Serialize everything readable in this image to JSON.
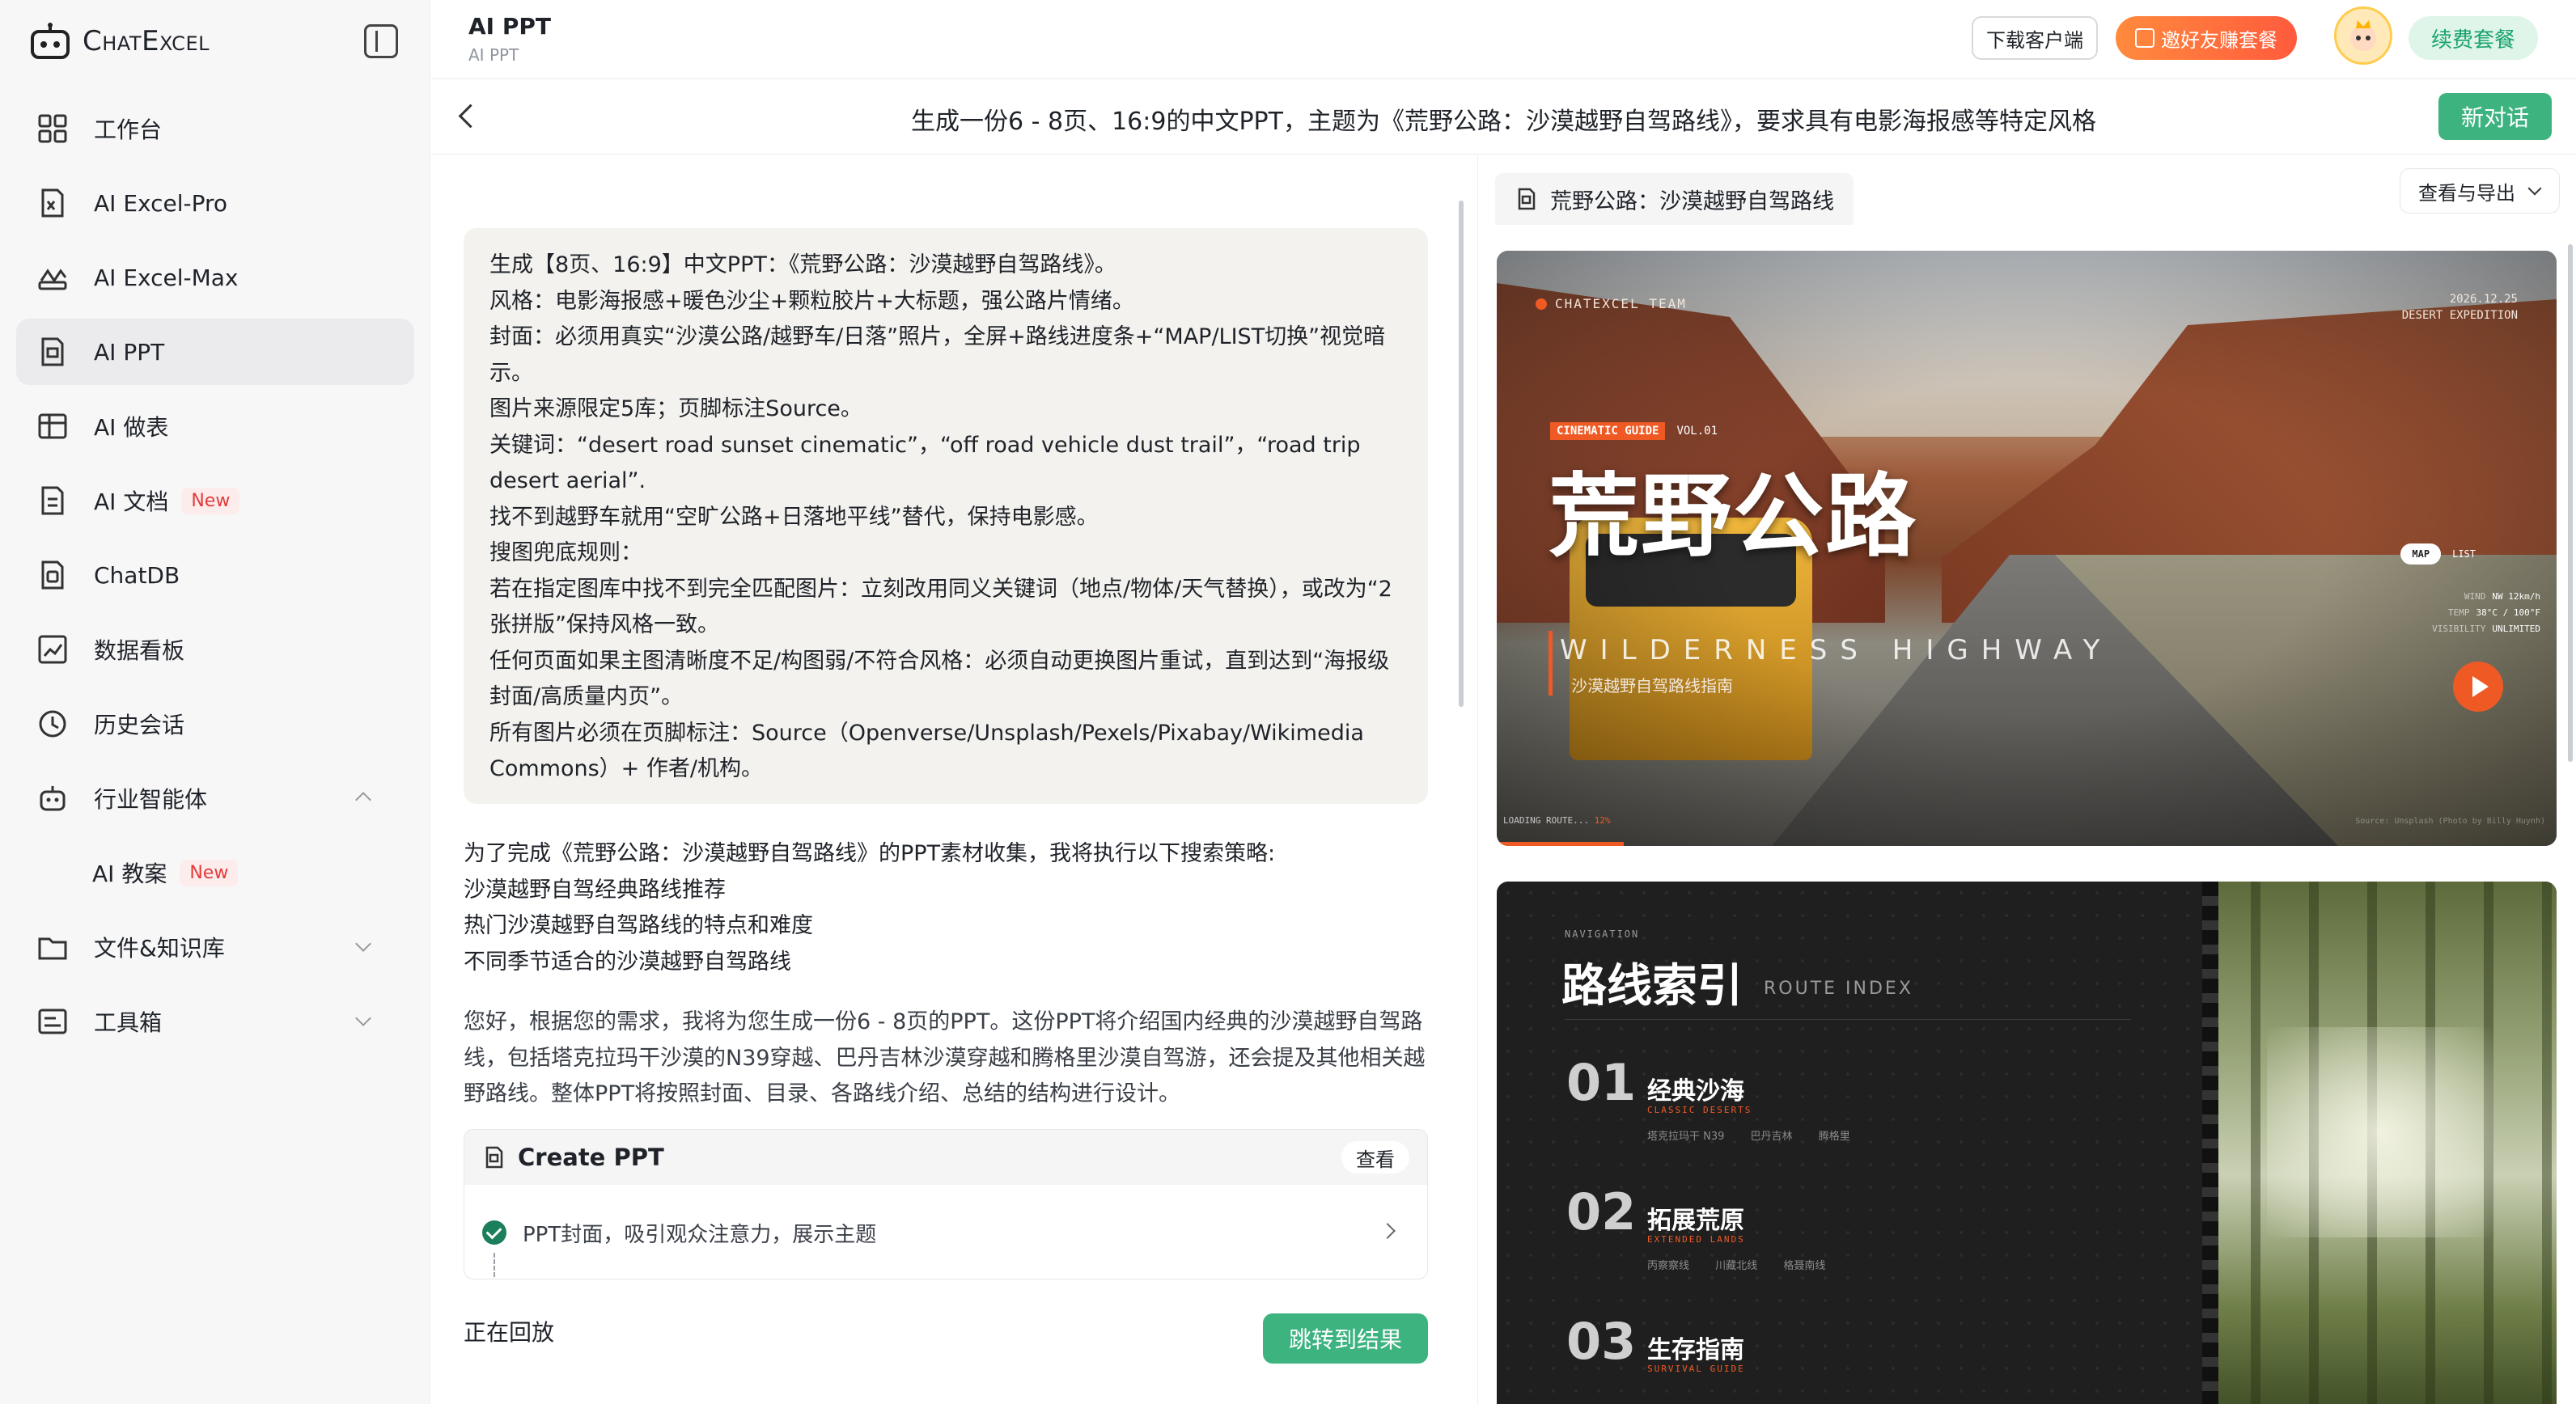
{
  "sidebar": {
    "brand": "ChatExcel",
    "items": [
      {
        "label": "工作台",
        "icon": "grid-icon"
      },
      {
        "label": "AI Excel-Pro",
        "icon": "excel-pro-icon"
      },
      {
        "label": "AI Excel-Max",
        "icon": "excel-max-icon"
      },
      {
        "label": "AI PPT",
        "icon": "ppt-icon",
        "active": true
      },
      {
        "label": "AI 做表",
        "icon": "table-icon"
      },
      {
        "label": "AI 文档",
        "icon": "document-icon",
        "badge": "New"
      },
      {
        "label": "ChatDB",
        "icon": "database-icon"
      },
      {
        "label": "数据看板",
        "icon": "dashboard-icon"
      },
      {
        "label": "历史会话",
        "icon": "history-icon"
      },
      {
        "label": "行业智能体",
        "icon": "agent-icon",
        "expanded": true
      },
      {
        "label": "AI 教案",
        "badge": "New",
        "sub": true
      },
      {
        "label": "文件&知识库",
        "icon": "folder-icon",
        "expanded": false
      },
      {
        "label": "工具箱",
        "icon": "toolbox-icon",
        "expanded": false
      }
    ]
  },
  "header": {
    "title": "AI PPT",
    "subtitle": "AI PPT",
    "download_label": "下载客户端",
    "invite_label": "邀好友赚套餐",
    "renew_label": "续费套餐"
  },
  "conversation": {
    "title": "生成一份6 - 8页、16:9的中文PPT，主题为《荒野公路：沙漠越野自驾路线》，要求具有电影海报感等特定风格",
    "new_label": "新对话"
  },
  "chat": {
    "prompt_lines": [
      "生成【8页、16:9】中文PPT：《荒野公路：沙漠越野自驾路线》。",
      "风格：电影海报感+暖色沙尘+颗粒胶片+大标题，强公路片情绪。",
      "封面：必须用真实“沙漠公路/越野车/日落”照片，全屏+路线进度条+“MAP/LIST切换”视觉暗示。",
      "图片来源限定5库；页脚标注Source。",
      "关键词：“desert road sunset cinematic”，“off road vehicle dust trail”，“road trip desert aerial”.",
      "找不到越野车就用“空旷公路+日落地平线”替代，保持电影感。",
      "搜图兜底规则：",
      "若在指定图库中找不到完全匹配图片：立刻改用同义关键词（地点/物体/天气替换），或改为“2张拼版”保持风格一致。",
      "任何页面如果主图清晰度不足/构图弱/不符合风格：必须自动更换图片重试，直到达到“海报级封面/高质量内页”。",
      "所有图片必须在页脚标注：Source（Openverse/Unsplash/Pexels/Pixabay/Wikimedia Commons）+ 作者/机构。"
    ],
    "response1_lines": [
      "为了完成《荒野公路：沙漠越野自驾路线》的PPT素材收集，我将执行以下搜索策略:",
      "沙漠越野自驾经典路线推荐",
      "热门沙漠越野自驾路线的特点和难度",
      "不同季节适合的沙漠越野自驾路线"
    ],
    "response2": "您好，根据您的需求，我将为您生成一份6 - 8页的PPT。这份PPT将介绍国内经典的沙漠越野自驾路线，包括塔克拉玛干沙漠的N39穿越、巴丹吉林沙漠穿越和腾格里沙漠自驾游，还会提及其他相关越野路线。整体PPT将按照封面、目录、各路线介绍、总结的结构进行设计。",
    "task_title": "Create PPT",
    "task_view_label": "查看",
    "task_step": "PPT封面，吸引观众注意力，展示主题",
    "replay_label": "正在回放",
    "jump_label": "跳转到结果"
  },
  "preview": {
    "doc_title": "荒野公路：沙漠越野自驾路线",
    "export_label": "查看与导出",
    "slide1": {
      "team": "CHATEXCEL TEAM",
      "date_lines": [
        "2026.12.25",
        "DESERT EXPEDITION"
      ],
      "guide_tag": "CINEMATIC GUIDE",
      "vol": "VOL.01",
      "title": "荒野公路",
      "en_title": "WILDERNESS HIGHWAY",
      "cn_sub": "沙漠越野自驾路线指南",
      "toggle_on": "MAP",
      "toggle_off": "LIST",
      "stats": [
        {
          "k": "WIND",
          "v": "NW 12km/h"
        },
        {
          "k": "TEMP",
          "v": "38°C / 100°F"
        },
        {
          "k": "VISIBILITY",
          "v": "UNLIMITED"
        }
      ],
      "loading_label": "LOADING ROUTE...",
      "loading_pct": "12%",
      "progress": 0.12,
      "credit": "Source: Unsplash (Photo by Billy Huynh)"
    },
    "slide2": {
      "nav_label": "NAVIGATION",
      "title": "路线索引",
      "subtitle": "ROUTE INDEX",
      "items": [
        {
          "num": "01",
          "name": "经典沙海",
          "en": "CLASSIC DESERTS",
          "tags": [
            "塔克拉玛干 N39",
            "巴丹吉林",
            "腾格里"
          ]
        },
        {
          "num": "02",
          "name": "拓展荒原",
          "en": "EXTENDED LANDS",
          "tags": [
            "丙察察线",
            "川藏北线",
            "格聂南线"
          ]
        },
        {
          "num": "03",
          "name": "生存指南",
          "en": "SURVIVAL GUIDE",
          "tags": []
        }
      ]
    }
  },
  "colors": {
    "accent_green": "#3db380",
    "accent_orange": "#ef5a24",
    "badge_red": "#e23b3b"
  }
}
